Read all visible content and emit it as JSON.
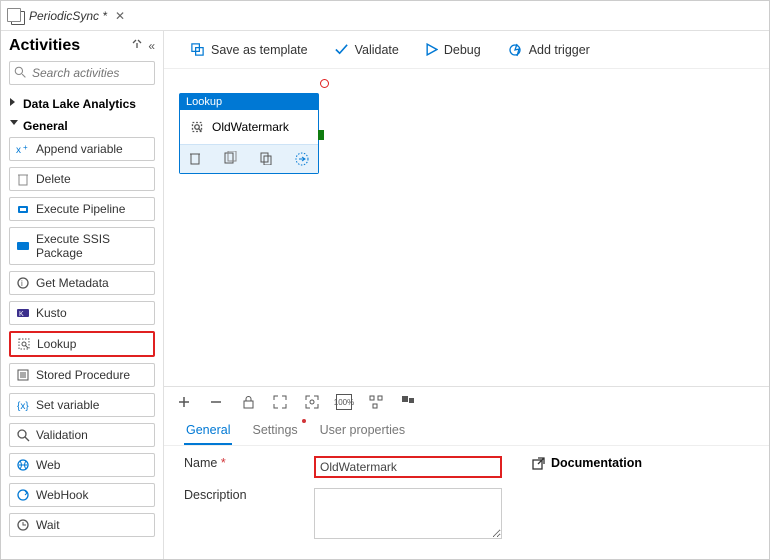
{
  "tab": {
    "title": "PeriodicSync *"
  },
  "sidebar": {
    "title": "Activities",
    "search_placeholder": "Search activities",
    "nodes": [
      {
        "label": "Data Lake Analytics",
        "expanded": false
      },
      {
        "label": "General",
        "expanded": true
      }
    ],
    "items": [
      {
        "label": "Append variable"
      },
      {
        "label": "Delete"
      },
      {
        "label": "Execute Pipeline"
      },
      {
        "label": "Execute SSIS Package"
      },
      {
        "label": "Get Metadata"
      },
      {
        "label": "Kusto"
      },
      {
        "label": "Lookup"
      },
      {
        "label": "Stored Procedure"
      },
      {
        "label": "Set variable"
      },
      {
        "label": "Validation"
      },
      {
        "label": "Web"
      },
      {
        "label": "WebHook"
      },
      {
        "label": "Wait"
      }
    ],
    "highlight_index": 6
  },
  "toolbar": {
    "save": "Save as template",
    "validate": "Validate",
    "debug": "Debug",
    "trigger": "Add trigger"
  },
  "canvas": {
    "node": {
      "type_label": "Lookup",
      "title": "OldWatermark"
    }
  },
  "prop_tabs": {
    "general": "General",
    "settings": "Settings",
    "user_props": "User properties"
  },
  "form": {
    "name_label": "Name",
    "name_value": "OldWatermark",
    "desc_label": "Description",
    "doc_link": "Documentation"
  }
}
